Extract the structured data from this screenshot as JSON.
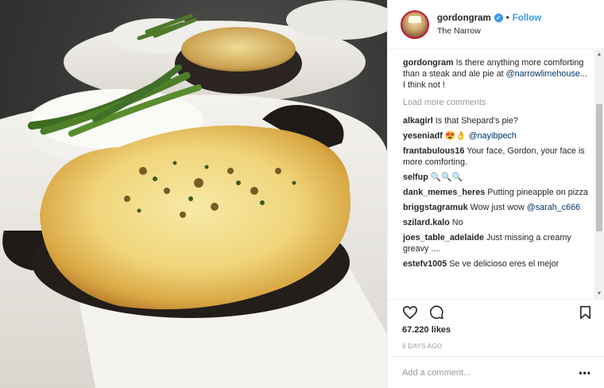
{
  "photo": {
    "alt_subject": "pie-photo"
  },
  "header": {
    "username": "gordongram",
    "verified_glyph": "✓",
    "separator": "•",
    "follow": "Follow",
    "location": "The Narrow"
  },
  "caption": {
    "username": "gordongram",
    "text_before": " Is there anything more comforting than a steak and ale pie at ",
    "mention": "@narrowlimehouse",
    "text_after": "... I think not !"
  },
  "load_more": "Load more comments",
  "comments": [
    {
      "user": "alkagirl",
      "text": " Is that Shepard's pie?",
      "mention": ""
    },
    {
      "user": "yeseniadf",
      "text": " 😍👌 ",
      "mention": "@nayibpech"
    },
    {
      "user": "frantabulous16",
      "text": " Your face, Gordon, your face is more comforting.",
      "mention": ""
    },
    {
      "user": "selfup",
      "text": " 🔍🔍🔍",
      "mention": ""
    },
    {
      "user": "dank_memes_heres",
      "text": " Putting pineapple on pizza",
      "mention": ""
    },
    {
      "user": "briggstagramuk",
      "text": " Wow just wow ",
      "mention": "@sarah_c666"
    },
    {
      "user": "szilard.kalo",
      "text": " No",
      "mention": ""
    },
    {
      "user": "joes_table_adelaide",
      "text": " Just missing a creamy greavy ....",
      "mention": ""
    },
    {
      "user": "estefv1005",
      "text": " Se ve delicioso eres el mejor",
      "mention": ""
    }
  ],
  "actions": {
    "like_icon": "heart-icon",
    "comment_icon": "comment-icon",
    "save_icon": "bookmark-icon"
  },
  "likes": "67.220 likes",
  "posted": "6 DAYS AGO",
  "add_comment": {
    "placeholder": "Add a comment...",
    "more": "•••"
  },
  "colors": {
    "accent": "#3897f0",
    "text": "#262626",
    "muted": "#999999",
    "border": "#efefef"
  }
}
